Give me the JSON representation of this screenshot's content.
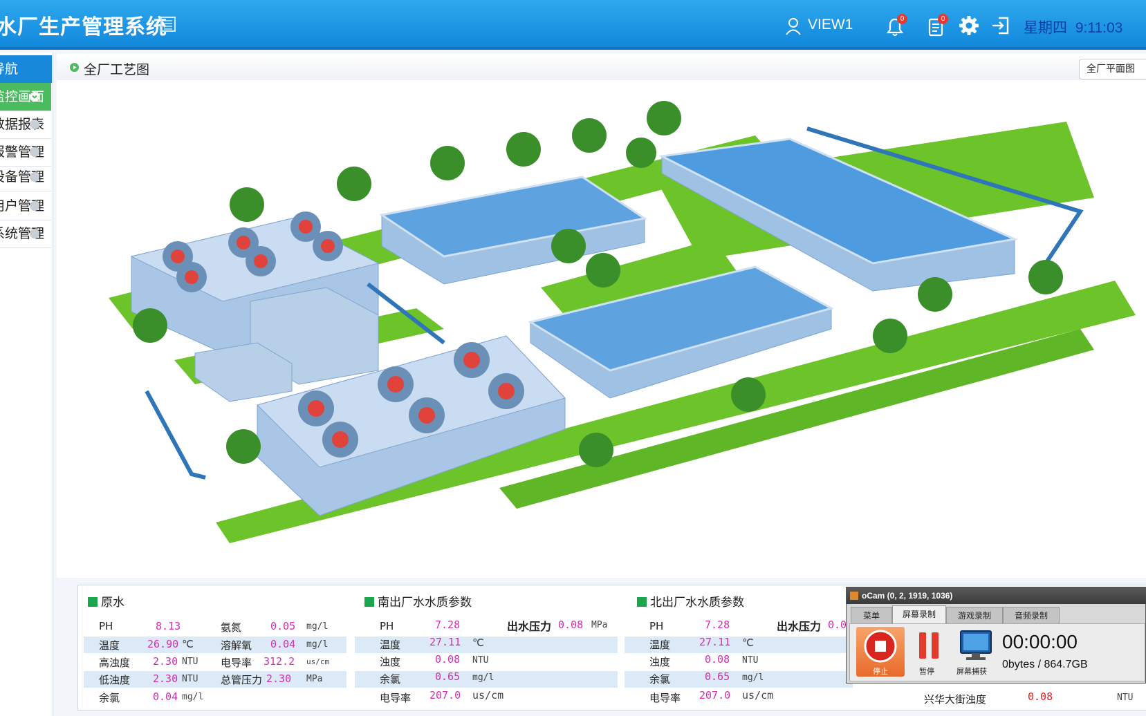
{
  "header": {
    "app_title": "水厂生产管理系统",
    "user": "VIEW1",
    "notifications_badge": "0",
    "tasks_badge": "0",
    "weekday": "星期四",
    "time": "9:11:03"
  },
  "sidebar": {
    "title": "导航",
    "items": [
      {
        "label": "监控画面",
        "active": true
      },
      {
        "label": "数据报表",
        "active": false
      },
      {
        "label": "报警管理",
        "active": false
      },
      {
        "label": "设备管理",
        "active": false
      },
      {
        "label": "用户管理",
        "active": false
      },
      {
        "label": "系统管理",
        "active": false
      }
    ]
  },
  "breadcrumb": {
    "title": "全厂工艺图",
    "plan_button": "全厂平面图"
  },
  "colors": {
    "header": "#1a96e4",
    "active_nav": "#4cbb60",
    "value": "#d42db2",
    "alert_value": "#d42323",
    "section_marker": "#1aa64a"
  },
  "raw_water": {
    "title": "原水",
    "rows": [
      {
        "l1": "PH",
        "v1": "8.13",
        "u1": "",
        "l2": "氨氮",
        "v2": "0.05",
        "u2": "mg/l"
      },
      {
        "l1": "温度",
        "v1": "26.90",
        "u1": "℃",
        "l2": "溶解氧",
        "v2": "0.04",
        "u2": "mg/l"
      },
      {
        "l1": "高浊度",
        "v1": "2.30",
        "u1": "NTU",
        "l2": "电导率",
        "v2": "312.2",
        "u2": "us/cm"
      },
      {
        "l1": "低浊度",
        "v1": "2.30",
        "u1": "NTU",
        "l2": "总管压力",
        "v2": "2.30",
        "u2": "MPa"
      },
      {
        "l1": "余氯",
        "v1": "0.04",
        "u1": "mg/l",
        "l2": "",
        "v2": "",
        "u2": ""
      }
    ]
  },
  "south_outlet": {
    "title": "南出厂水水质参数",
    "pressure_label": "出水压力",
    "pressure_value": "0.08",
    "pressure_unit": "MPa",
    "rows": [
      {
        "label": "PH",
        "value": "7.28",
        "unit": ""
      },
      {
        "label": "温度",
        "value": "27.11",
        "unit": "℃"
      },
      {
        "label": "浊度",
        "value": "0.08",
        "unit": "NTU"
      },
      {
        "label": "余氯",
        "value": "0.65",
        "unit": "mg/l"
      },
      {
        "label": "电导率",
        "value": "207.0",
        "unit": "us/cm"
      }
    ]
  },
  "north_outlet": {
    "title": "北出厂水水质参数",
    "pressure_label": "出水压力",
    "pressure_value": "0.0",
    "rows": [
      {
        "label": "PH",
        "value": "7.28",
        "unit": ""
      },
      {
        "label": "温度",
        "value": "27.11",
        "unit": "℃"
      },
      {
        "label": "浊度",
        "value": "0.08",
        "unit": "NTU"
      },
      {
        "label": "余氯",
        "value": "0.65",
        "unit": "mg/l"
      },
      {
        "label": "电导率",
        "value": "207.0",
        "unit": "us/cm"
      }
    ]
  },
  "street": {
    "label": "兴华大街浊度",
    "value": "0.08",
    "unit": "NTU"
  },
  "ocam": {
    "title": "oCam (0, 2, 1919, 1036)",
    "tabs": [
      "菜单",
      "屏幕录制",
      "游戏录制",
      "音频录制"
    ],
    "active_tab": 1,
    "stop": "停止",
    "pause": "暂停",
    "capture": "屏幕捕获",
    "timer": "00:00:00",
    "size": "0bytes / 864.7GB"
  }
}
